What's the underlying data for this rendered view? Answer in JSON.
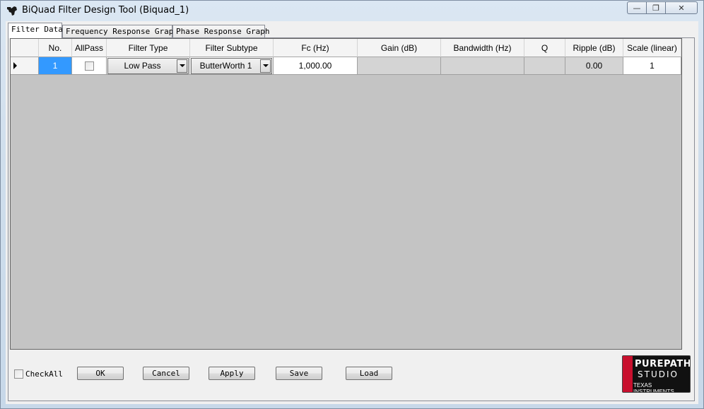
{
  "window": {
    "title": "BiQuad Filter Design Tool (Biquad_1)",
    "minimize_glyph": "—",
    "maximize_glyph": "❐",
    "close_glyph": "✕"
  },
  "tabs": [
    {
      "label": "Filter Data",
      "active": true
    },
    {
      "label": "Frequency Response Graph",
      "active": false
    },
    {
      "label": "Phase Response Graph",
      "active": false
    }
  ],
  "grid": {
    "columns": [
      "No.",
      "AllPass",
      "Filter Type",
      "Filter Subtype",
      "Fc (Hz)",
      "Gain (dB)",
      "Bandwidth (Hz)",
      "Q",
      "Ripple (dB)",
      "Scale (linear)"
    ],
    "rows": [
      {
        "no": "1",
        "allpass": false,
        "filter_type": "Low Pass",
        "filter_subtype": "ButterWorth 1",
        "fc": "1,000.00",
        "gain": "",
        "bandwidth": "",
        "q": "",
        "ripple": "0.00",
        "scale": "1"
      }
    ]
  },
  "bottom": {
    "checkall_label": "CheckAll",
    "checkall_checked": false,
    "buttons": {
      "ok": "OK",
      "cancel": "Cancel",
      "apply": "Apply",
      "save": "Save",
      "load": "Load"
    }
  },
  "logo": {
    "line1": "PUREPATH",
    "line2": "STUDIO",
    "line3": "TEXAS INSTRUMENTS"
  },
  "colors": {
    "selection": "#3399ff",
    "grid_background": "#c4c4c4",
    "logo_red": "#c8102e"
  }
}
